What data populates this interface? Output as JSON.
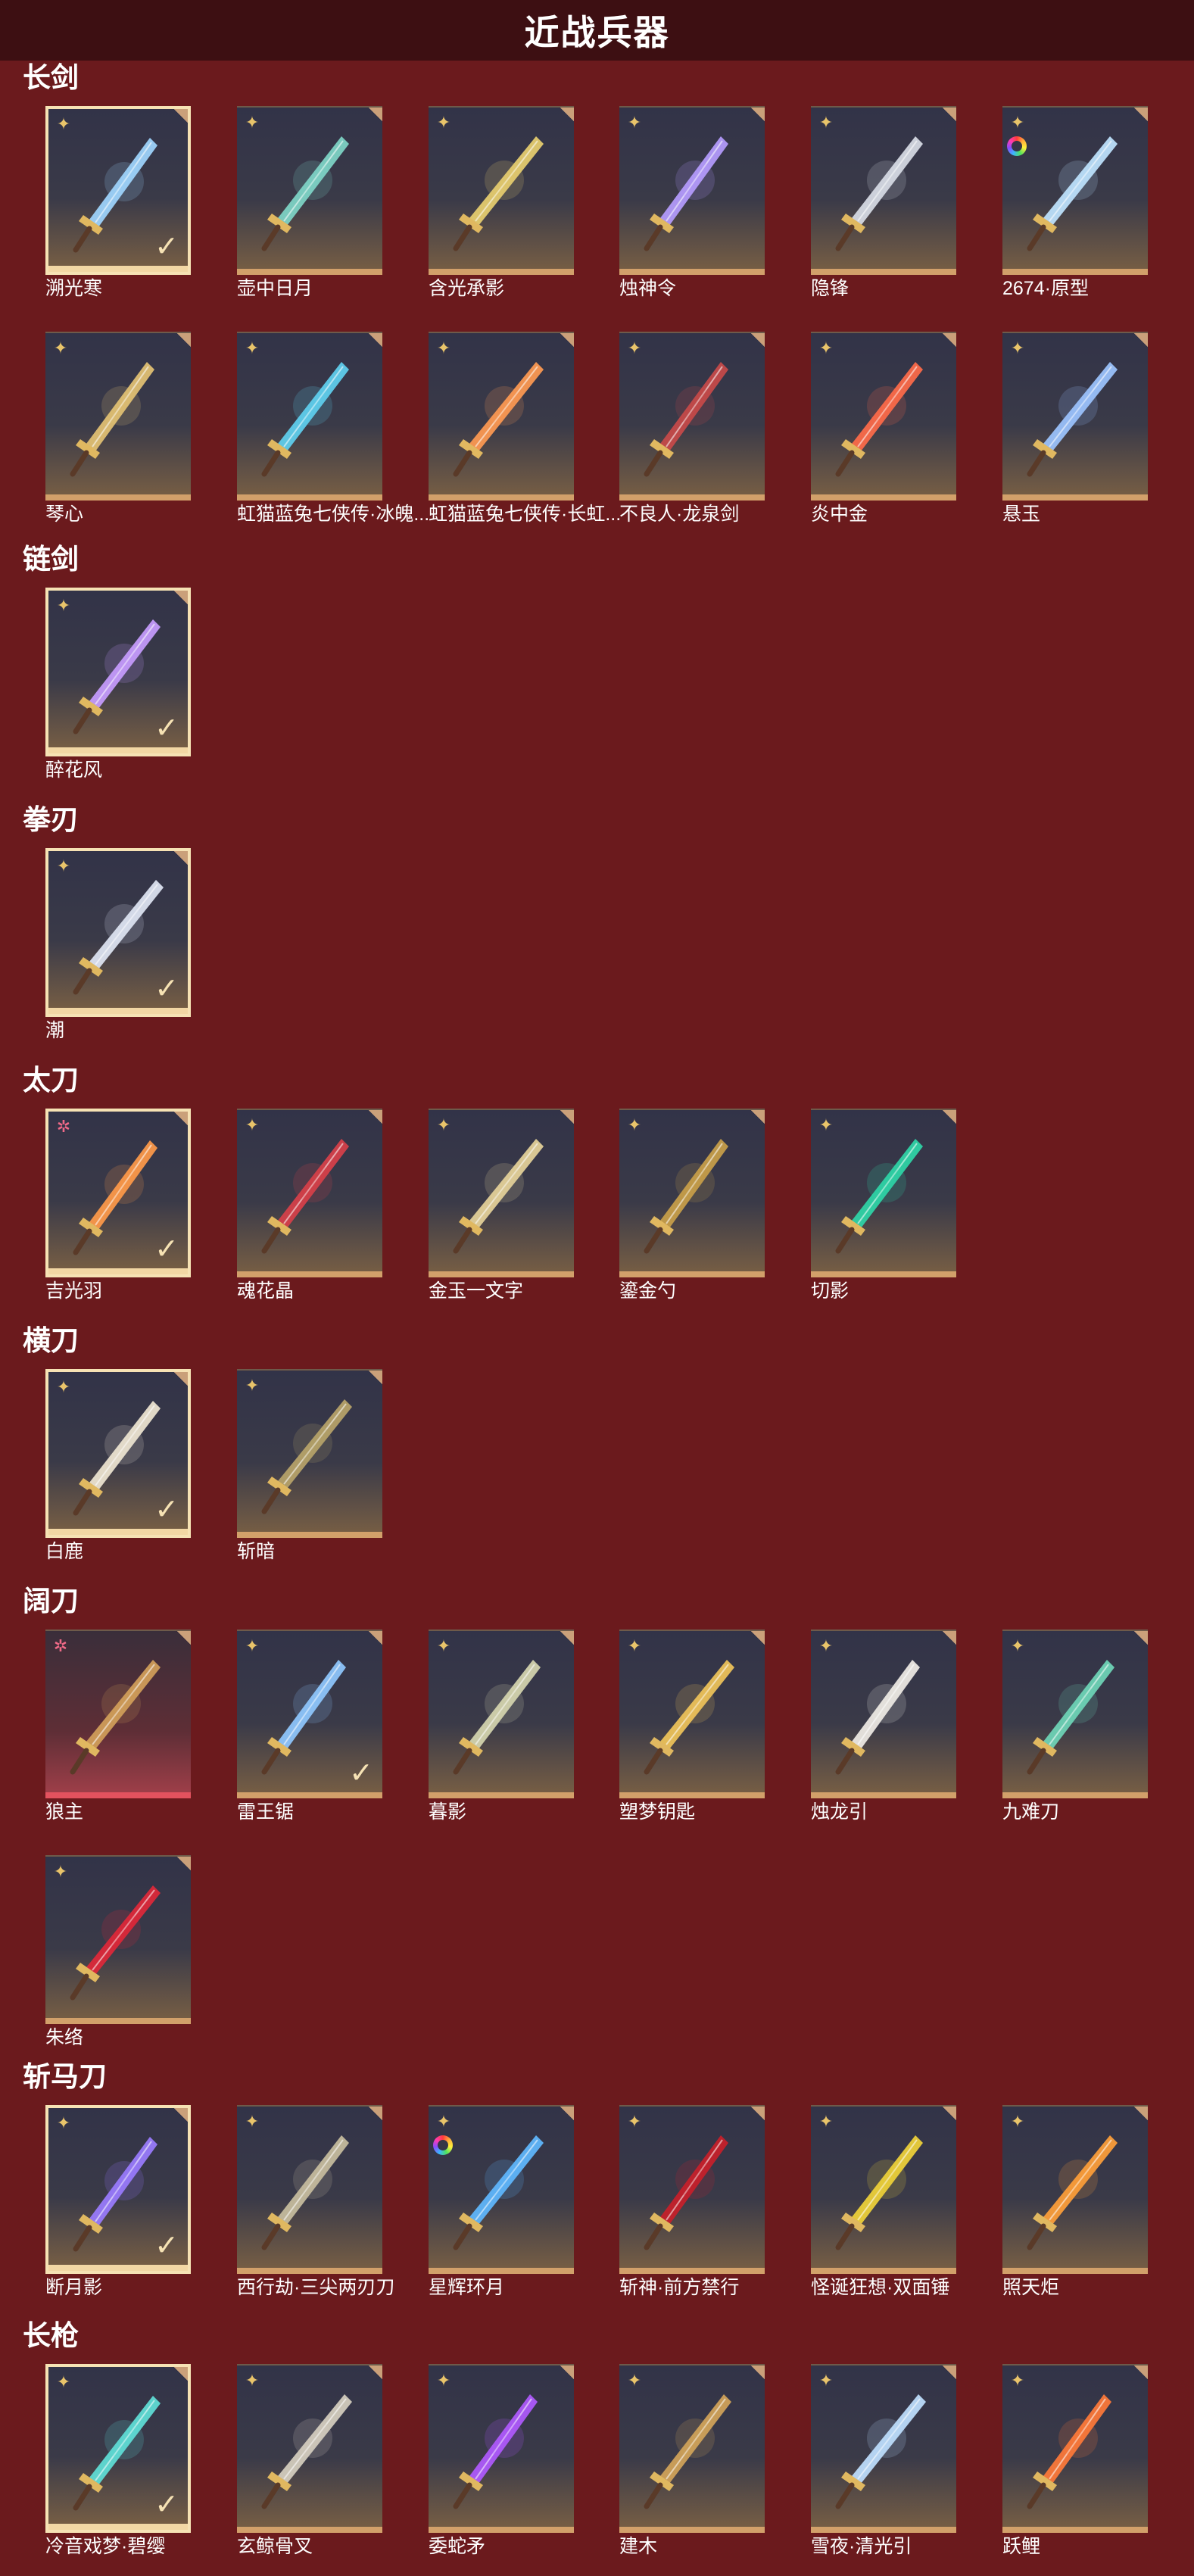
{
  "page": {
    "title": "近战兵器"
  },
  "sections": [
    {
      "name": "长剑",
      "items": [
        {
          "name": "溯光寒",
          "badge": "star",
          "checked": true,
          "selected": true,
          "hue": "#9fd6ff"
        },
        {
          "name": "壶中日月",
          "badge": "star",
          "hue": "#7fd6c8"
        },
        {
          "name": "含光承影",
          "badge": "star",
          "hue": "#e8cf70"
        },
        {
          "name": "烛神令",
          "badge": "star",
          "hue": "#b59cff"
        },
        {
          "name": "隐锋",
          "badge": "star",
          "hue": "#d8dce6"
        },
        {
          "name": "2674·原型",
          "badge": "star",
          "rainbow": true,
          "hue": "#bfe4ff"
        },
        {
          "name": "琴心",
          "badge": "star",
          "hue": "#e4c274"
        },
        {
          "name": "虹猫蓝兔七侠传·冰魄...",
          "badge": "star",
          "hue": "#5fd0f0"
        },
        {
          "name": "虹猫蓝兔七侠传·长虹...",
          "badge": "star",
          "hue": "#ff9a52"
        },
        {
          "name": "不良人·龙泉剑",
          "badge": "star",
          "hue": "#c84a4a"
        },
        {
          "name": "炎中金",
          "badge": "star",
          "hue": "#ff6b4a"
        },
        {
          "name": "悬玉",
          "badge": "star",
          "hue": "#9cc4ff"
        }
      ]
    },
    {
      "name": "链剑",
      "items": [
        {
          "name": "醉花风",
          "badge": "star",
          "checked": true,
          "selected": true,
          "hue": "#c79cff"
        }
      ]
    },
    {
      "name": "拳刃",
      "items": [
        {
          "name": "潮",
          "badge": "star",
          "checked": true,
          "selected": true,
          "hue": "#dfe6f4"
        }
      ]
    },
    {
      "name": "太刀",
      "items": [
        {
          "name": "吉光羽",
          "badge": "pinkstar",
          "checked": true,
          "selected": true,
          "hue": "#ff9a4a"
        },
        {
          "name": "魂花晶",
          "badge": "star",
          "hue": "#d8404a"
        },
        {
          "name": "金玉一文字",
          "badge": "star",
          "hue": "#e6d29a"
        },
        {
          "name": "鎏金勺",
          "badge": "star",
          "hue": "#c9a04a"
        },
        {
          "name": "切影",
          "badge": "star",
          "hue": "#2fd6a8"
        }
      ]
    },
    {
      "name": "横刀",
      "items": [
        {
          "name": "白鹿",
          "badge": "star",
          "checked": true,
          "selected": true,
          "hue": "#efe6d2"
        },
        {
          "name": "斩暗",
          "badge": "star",
          "hue": "#b8a46a"
        }
      ]
    },
    {
      "name": "阔刀",
      "items": [
        {
          "name": "狼主",
          "badge": "pinkstar",
          "pinkbg": true,
          "hue": "#d2a05a"
        },
        {
          "name": "雷王锯",
          "badge": "star",
          "checked": true,
          "hue": "#8fc8ff"
        },
        {
          "name": "暮影",
          "badge": "star",
          "hue": "#d6d6b0"
        },
        {
          "name": "塑梦钥匙",
          "badge": "star",
          "hue": "#f0c45a"
        },
        {
          "name": "烛龙引",
          "badge": "star",
          "hue": "#f0ece6"
        },
        {
          "name": "九难刀",
          "badge": "star",
          "hue": "#6fd6b8"
        },
        {
          "name": "朱络",
          "badge": "star",
          "hue": "#e0283a"
        }
      ]
    },
    {
      "name": "斩马刀",
      "items": [
        {
          "name": "断月影",
          "badge": "star",
          "checked": true,
          "selected": true,
          "hue": "#9a7cff"
        },
        {
          "name": "西行劫·三尖两刃刀",
          "badge": "star",
          "hue": "#c8bea0"
        },
        {
          "name": "星辉环月",
          "badge": "star",
          "rainbow": true,
          "hue": "#5fb8ff"
        },
        {
          "name": "斩神·前方禁行",
          "badge": "star",
          "hue": "#c8202a"
        },
        {
          "name": "怪诞狂想·双面锤",
          "badge": "star",
          "hue": "#f0d23a"
        },
        {
          "name": "照天炬",
          "badge": "star",
          "hue": "#ffa03a"
        }
      ]
    },
    {
      "name": "长枪",
      "items": [
        {
          "name": "冷音戏梦·碧缨",
          "badge": "star",
          "checked": true,
          "selected": true,
          "hue": "#5fe0d8"
        },
        {
          "name": "玄鲸骨叉",
          "badge": "star",
          "hue": "#d6cfc0"
        },
        {
          "name": "委蛇矛",
          "badge": "star",
          "hue": "#b05aff"
        },
        {
          "name": "建木",
          "badge": "star",
          "hue": "#d2a45a"
        },
        {
          "name": "雪夜·清光引",
          "badge": "star",
          "hue": "#bfe0ff"
        },
        {
          "name": "跃鲤",
          "badge": "star",
          "hue": "#ff7a3a"
        }
      ]
    }
  ]
}
